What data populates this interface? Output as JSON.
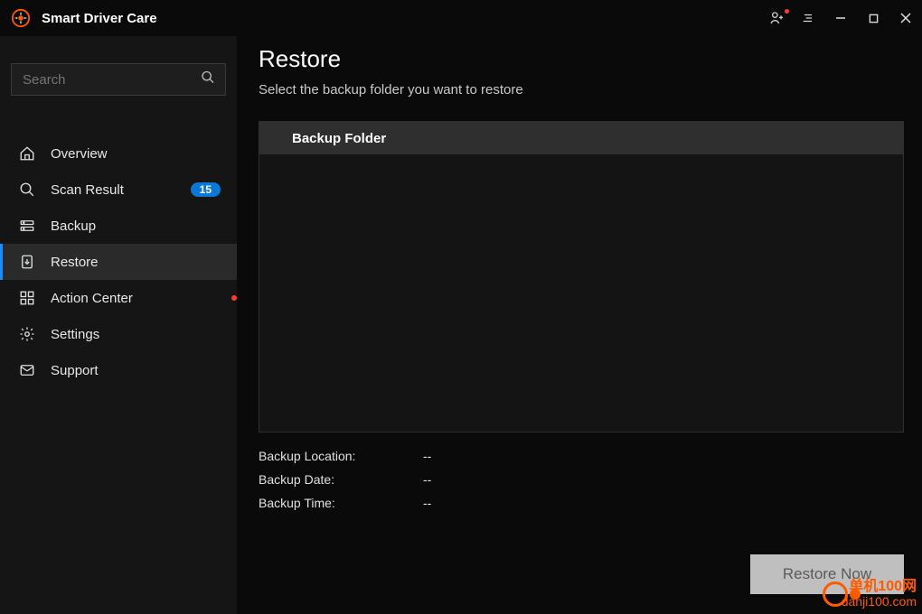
{
  "app": {
    "title": "Smart Driver Care"
  },
  "search": {
    "placeholder": "Search"
  },
  "sidebar": {
    "items": [
      {
        "id": "overview",
        "label": "Overview",
        "icon": "home-icon",
        "active": false
      },
      {
        "id": "scan-result",
        "label": "Scan Result",
        "icon": "magnifier-icon",
        "badge": "15",
        "active": false
      },
      {
        "id": "backup",
        "label": "Backup",
        "icon": "backup-icon",
        "active": false
      },
      {
        "id": "restore",
        "label": "Restore",
        "icon": "restore-icon",
        "active": true
      },
      {
        "id": "action-center",
        "label": "Action Center",
        "icon": "grid-icon",
        "dot": true,
        "active": false
      },
      {
        "id": "settings",
        "label": "Settings",
        "icon": "gear-icon",
        "active": false
      },
      {
        "id": "support",
        "label": "Support",
        "icon": "envelope-icon",
        "active": false
      }
    ]
  },
  "page": {
    "title": "Restore",
    "subtitle": "Select the backup folder you want to restore"
  },
  "panel": {
    "header": "Backup Folder"
  },
  "details": {
    "rows": [
      {
        "label": "Backup Location:",
        "value": "--"
      },
      {
        "label": "Backup Date:",
        "value": "--"
      },
      {
        "label": "Backup Time:",
        "value": "--"
      }
    ]
  },
  "actions": {
    "restore": "Restore Now"
  },
  "watermark": {
    "line1": "单机100网",
    "line2": "danji100.com"
  }
}
